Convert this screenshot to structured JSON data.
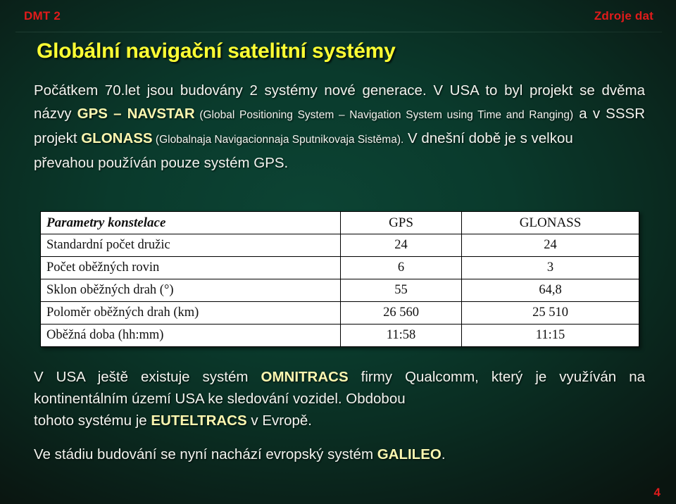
{
  "slide": {
    "header": {
      "left_label": "DMT 2",
      "right_label": "Zdroje dat",
      "accent_color": "#e01b1b"
    },
    "title": "Globální navigační satelitní systémy",
    "title_color": "#ffff33",
    "background_color": "#0a3a2c",
    "page_number": "4",
    "paragraph1": {
      "seg1": "Počátkem 70.let jsou budovány 2 systémy nové generace. V USA to byl projekt se dvěma názvy ",
      "hl1": "GPS – NAVSTAR",
      "seg2": " (Global Positioning System – Navigation System using Time and Ranging)",
      "seg3": " a v SSSR projekt ",
      "hl2": "GLONASS",
      "seg4": " (Globalnaja Navigacionnaja Sputnikovaja Sistěma).",
      "seg5": " V dnešní době je s velkou",
      "lastline": "převahou používán pouze systém GPS."
    },
    "paragraph2": {
      "seg1": "V USA ještě existuje systém ",
      "hl1": "OMNITRACS",
      "seg2": " firmy Qualcomm, který je využíván na kontinentálním území USA ke sledování vozidel. Obdobou",
      "lastline_pre": "tohoto systému je ",
      "hl2": "EUTELTRACS",
      "lastline_post": " v Evropě."
    },
    "paragraph3": {
      "seg1": "Ve stádiu budování se nyní nachází evropský systém ",
      "hl1": "GALILEO",
      "seg2": "."
    },
    "table": {
      "headers": [
        "Parametry konstelace",
        "GPS",
        "GLONASS"
      ],
      "rows": [
        {
          "label": "Standardní počet družic",
          "gps": "24",
          "glonass": "24"
        },
        {
          "label": "Počet oběžných rovin",
          "gps": "6",
          "glonass": "3"
        },
        {
          "label": "Sklon oběžných drah (°)",
          "gps": "55",
          "glonass": "64,8"
        },
        {
          "label": "Poloměr oběžných drah (km)",
          "gps": "26 560",
          "glonass": "25 510"
        },
        {
          "label": "Oběžná doba (hh:mm)",
          "gps": "11:58",
          "glonass": "11:15"
        }
      ]
    }
  }
}
